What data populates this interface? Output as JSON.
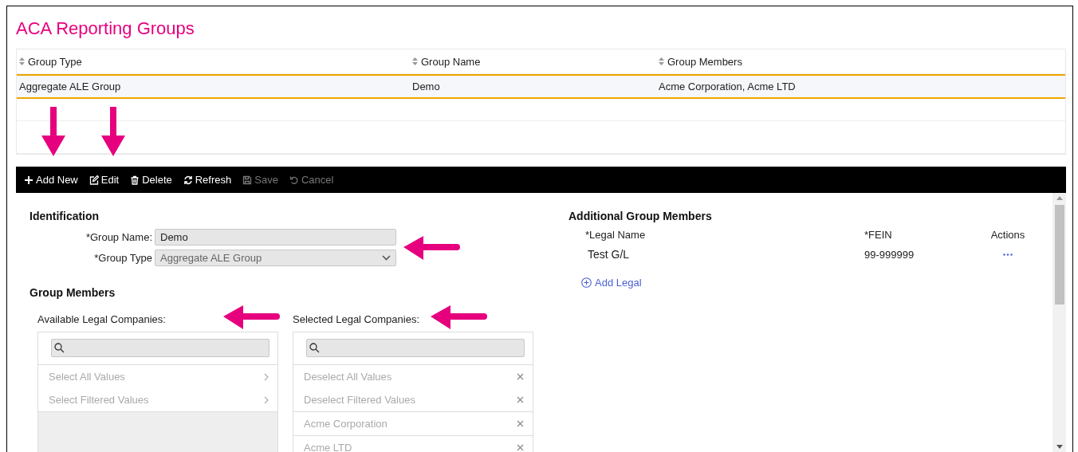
{
  "title": "ACA Reporting Groups",
  "table": {
    "columns": [
      "Group Type",
      "Group Name",
      "Group Members"
    ],
    "rows": [
      {
        "cells": [
          "Aggregate ALE Group",
          "Demo",
          "Acme Corporation, Acme LTD"
        ],
        "selected": true
      }
    ]
  },
  "toolbar": [
    {
      "label": "Add New",
      "kind": "plus",
      "disabled": false
    },
    {
      "label": "Edit",
      "kind": "edit",
      "disabled": false
    },
    {
      "label": "Delete",
      "kind": "trash",
      "disabled": false
    },
    {
      "label": "Refresh",
      "kind": "refresh",
      "disabled": false
    },
    {
      "label": "Save",
      "kind": "save",
      "disabled": true
    },
    {
      "label": "Cancel",
      "kind": "undo",
      "disabled": true
    }
  ],
  "identification": {
    "title": "Identification",
    "fields": [
      {
        "label": "*Group Name:",
        "value": "Demo",
        "kind": "text"
      },
      {
        "label": "*Group Type",
        "value": "Aggregate ALE Group",
        "kind": "select"
      }
    ]
  },
  "group_members": {
    "title": "Group Members",
    "lists": [
      {
        "label": "Available Legal Companies:",
        "kind": "select",
        "actions": [
          "Select All Values",
          "Select Filtered Values"
        ]
      },
      {
        "label": "Selected Legal Companies:",
        "kind": "remove",
        "actions": [
          "Deselect All Values",
          "Deselect Filtered Values"
        ],
        "items": [
          "Acme Corporation",
          "Acme LTD"
        ]
      }
    ]
  },
  "additional": {
    "title": "Additional Group Members",
    "columns": [
      "*Legal Name",
      "*FEIN",
      "Actions"
    ],
    "rows": [
      {
        "legal_name": "Test G/L",
        "fein": "99-999999"
      }
    ],
    "add_link": "Add Legal"
  }
}
